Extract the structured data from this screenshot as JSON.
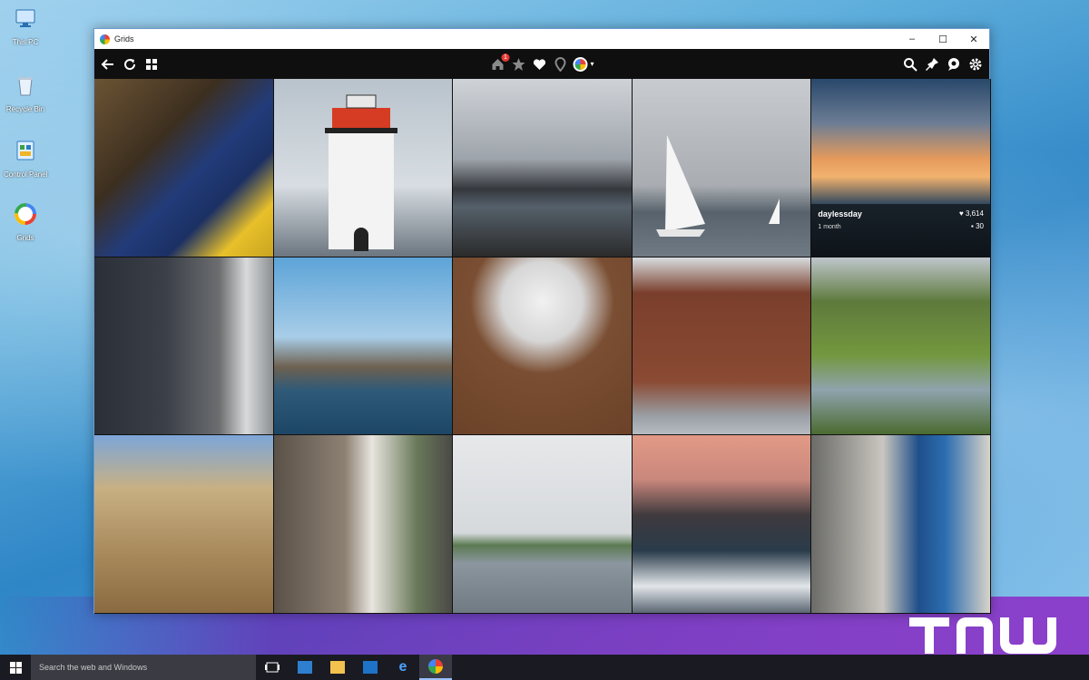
{
  "desktop": {
    "icons": [
      {
        "label": "This PC",
        "icon": "computer-icon"
      },
      {
        "label": "Recycle Bin",
        "icon": "recycle-bin-icon"
      },
      {
        "label": "Control Panel",
        "icon": "control-panel-icon"
      },
      {
        "label": "Grids",
        "icon": "grids-app-icon"
      }
    ]
  },
  "window": {
    "title": "Grids",
    "controls": {
      "minimize": "–",
      "maximize": "☐",
      "close": "✕"
    }
  },
  "toolbar": {
    "left": [
      "back-arrow-icon",
      "refresh-icon",
      "grid-view-icon"
    ],
    "center": [
      "home-icon",
      "star-icon",
      "heart-icon",
      "location-pin-icon",
      "profile-avatar"
    ],
    "home_badge": "1",
    "right": [
      "search-icon",
      "pin-icon",
      "chat-icon",
      "settings-gear-icon"
    ]
  },
  "photo_grid": {
    "columns": 5,
    "rows": 3,
    "tiles": [
      {
        "subject": "feet-on-dock"
      },
      {
        "subject": "lighthouse"
      },
      {
        "subject": "coast-wedding"
      },
      {
        "subject": "sailboats"
      },
      {
        "subject": "sunset-harbor",
        "user": "daylessday",
        "time": "1 month",
        "likes": "3,614",
        "comments": "30"
      },
      {
        "subject": "cozy-room"
      },
      {
        "subject": "city-waterfront"
      },
      {
        "subject": "dress-wreath"
      },
      {
        "subject": "brick-building"
      },
      {
        "subject": "hill-village"
      },
      {
        "subject": "tall-grass-portrait"
      },
      {
        "subject": "alley-street"
      },
      {
        "subject": "foggy-lake"
      },
      {
        "subject": "marina-dusk"
      },
      {
        "subject": "blue-umbrella"
      }
    ]
  },
  "taskbar": {
    "search_placeholder": "Search the web and Windows",
    "apps": [
      "task-view-icon",
      "store-icon",
      "file-explorer-icon",
      "mail-icon",
      "edge-icon",
      "grids-app-icon"
    ]
  },
  "watermark": {
    "text": "TNW"
  },
  "colors": {
    "toolbar_bg": "#0f0f0f",
    "badge": "#e53935",
    "accent_purple": "#7a2fbd"
  }
}
